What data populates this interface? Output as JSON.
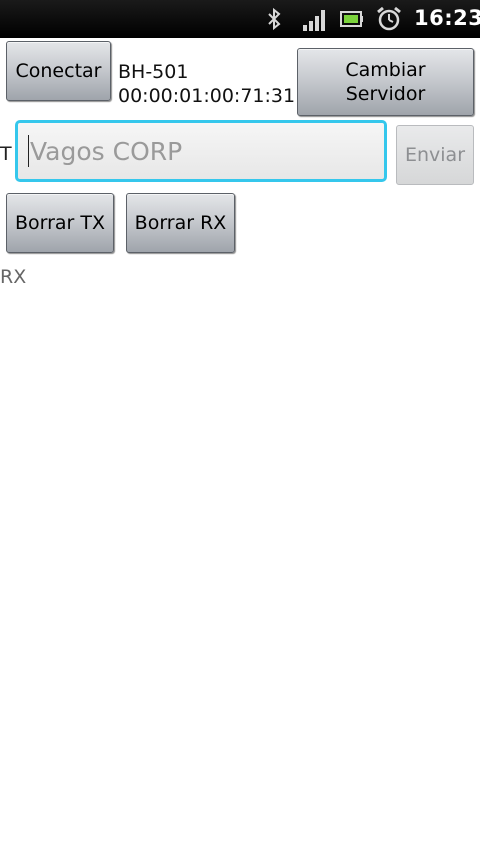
{
  "status_bar": {
    "time": "16:23",
    "icons": [
      "bluetooth-icon",
      "signal-icon",
      "battery-icon",
      "alarm-clock-icon"
    ]
  },
  "buttons": {
    "connect": "Conectar",
    "change_server": "Cambiar\nServidor",
    "send": "Enviar",
    "clear_tx": "Borrar TX",
    "clear_rx": "Borrar RX"
  },
  "device": {
    "name": "BH-501",
    "address": "00:00:01:00:71:31"
  },
  "tx": {
    "label": "T",
    "input_value": "",
    "placeholder": "Vagos CORP"
  },
  "rx": {
    "label": "RX",
    "content": ""
  },
  "colors": {
    "input_focus_border": "#35c7ec",
    "status_bar_bg": "#000000"
  }
}
